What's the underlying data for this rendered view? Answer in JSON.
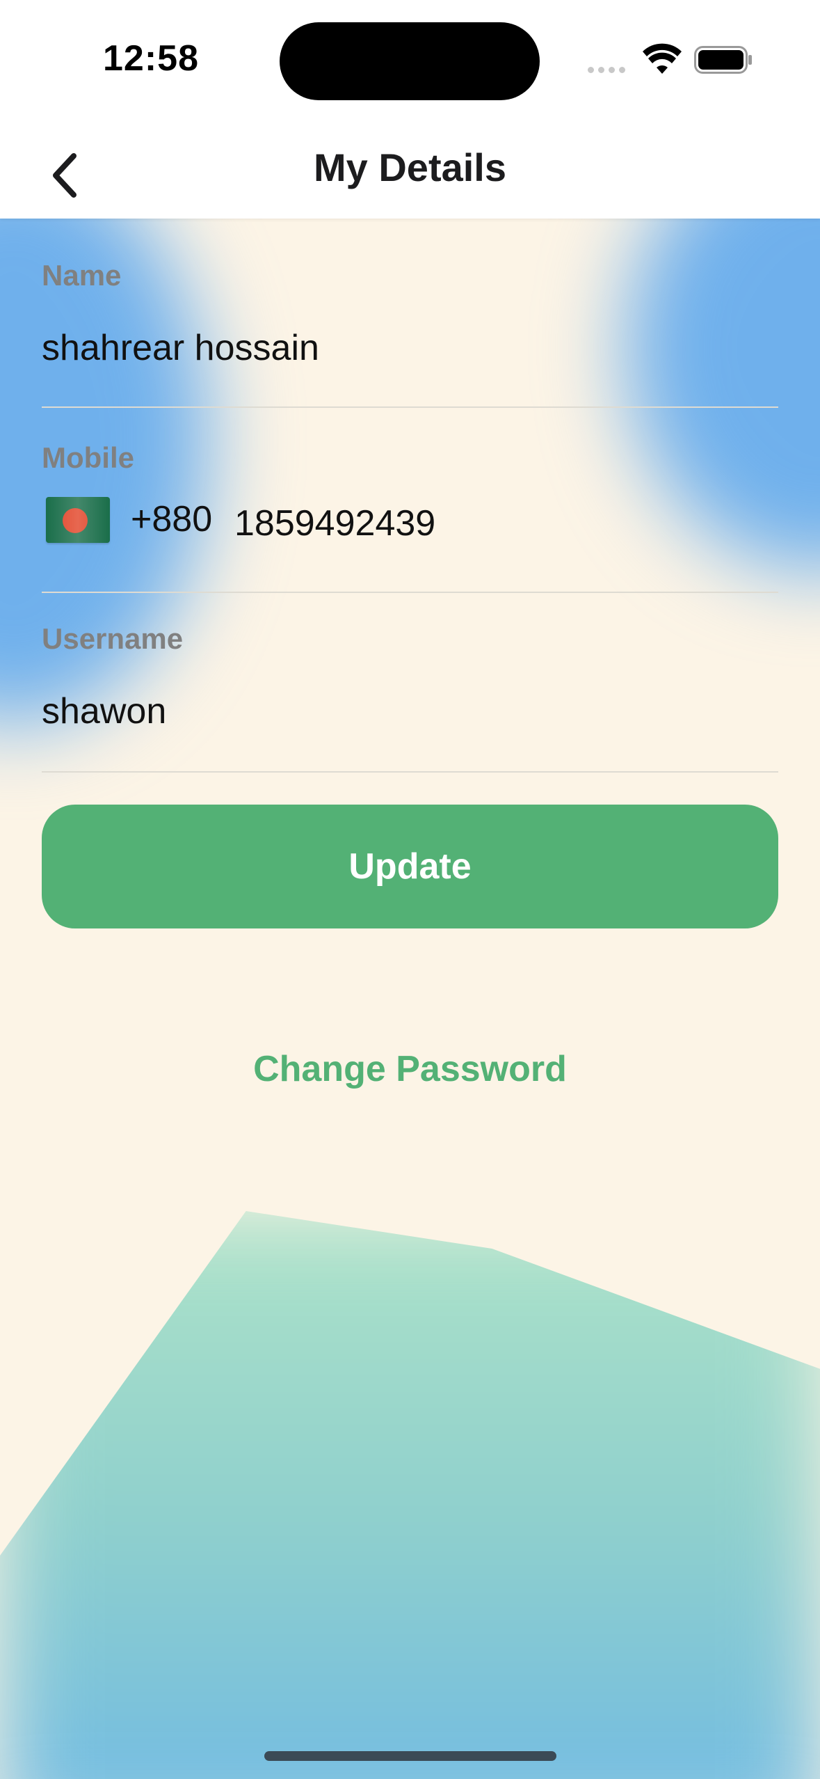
{
  "status_bar": {
    "time": "12:58"
  },
  "nav": {
    "title": "My Details",
    "back_icon": "chevron-left-icon"
  },
  "form": {
    "name": {
      "label": "Name",
      "value": "shahrear hossain"
    },
    "mobile": {
      "label": "Mobile",
      "flag_icon": "bangladesh-flag-icon",
      "dial_code": "+880",
      "number": "1859492439"
    },
    "username": {
      "label": "Username",
      "value": "shawon"
    }
  },
  "actions": {
    "update_label": "Update",
    "change_password_label": "Change Password"
  },
  "colors": {
    "accent": "#53b175",
    "background": "#fcf4e6",
    "blob_blue": "#6fb0ec",
    "blob_green": "#aee3c9"
  }
}
